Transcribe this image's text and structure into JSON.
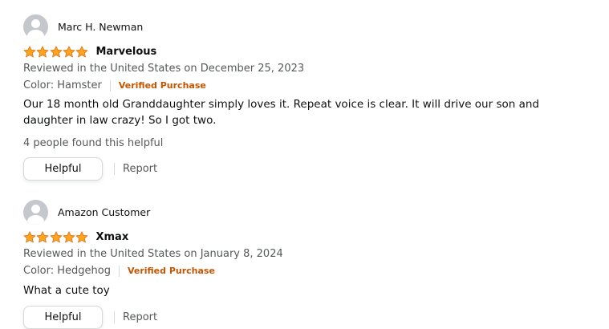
{
  "reviews": [
    {
      "profile_name": "Marc H. Newman",
      "rating": 5,
      "rating_max": 5,
      "title": "Marvelous",
      "date": "Reviewed in the United States on December 25, 2023",
      "color": "Color: Hamster",
      "verified": "Verified Purchase",
      "body": "Our 18 month old Granddaughter simply loves it. Repeat voice is clear. It will drive our son and daughter in law crazy! So I got two.",
      "helpful_count": "4 people found this helpful",
      "helpful_label": "Helpful",
      "report_label": "Report"
    },
    {
      "profile_name": "Amazon Customer",
      "rating": 5,
      "rating_max": 5,
      "title": "Xmax",
      "date": "Reviewed in the United States on January 8, 2024",
      "color": "Color: Hedgehog",
      "verified": "Verified Purchase",
      "body": "What a cute toy",
      "helpful_label": "Helpful",
      "report_label": "Report"
    }
  ],
  "colors": {
    "star": "#ffa41c",
    "star_outline": "#de7921",
    "verified": "#c45500",
    "secondary_text": "#565959"
  },
  "icons": {
    "avatar": "default-avatar-icon",
    "star": "star-icon"
  }
}
